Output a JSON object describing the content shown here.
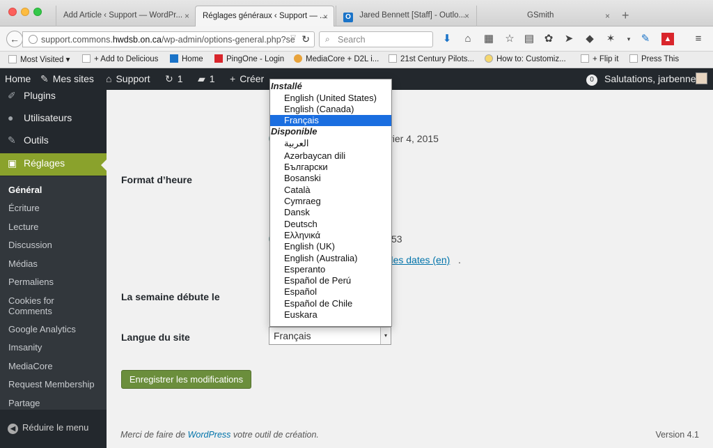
{
  "browser": {
    "tabs": [
      {
        "title": "Add Article ‹ Support — WordPr..."
      },
      {
        "title": "Réglages généraux ‹ Support — ..."
      },
      {
        "title": "Jared Bennett [Staff] - Outlo..."
      },
      {
        "title": "GSmith"
      }
    ],
    "close_glyph": "×",
    "newtab_glyph": "+",
    "url_prefix": "support.commons.",
    "url_host": "hwdsb.on.ca",
    "url_path": "/wp-admin/options-general.php?se",
    "search_placeholder": "Search",
    "bookmarks": [
      "Most Visited ▾",
      "+ Add to Delicious",
      "Home",
      "PingOne - Login",
      "MediaCore + D2L i...",
      "21st Century Pilots...",
      "How to: Customiz...",
      "+ Flip it",
      "Press This"
    ]
  },
  "adminbar": {
    "home": "Home",
    "mes_sites": "Mes sites",
    "site_name": "Support",
    "updates_count": "1",
    "comments_count": "1",
    "create": "Créer",
    "notif_count": "0",
    "greeting": "Salutations, jarbenne"
  },
  "sidebar": {
    "items": [
      {
        "label": "Plugins",
        "icon": "plugin-icon"
      },
      {
        "label": "Utilisateurs",
        "icon": "users-icon"
      },
      {
        "label": "Outils",
        "icon": "tools-icon"
      },
      {
        "label": "Réglages",
        "icon": "settings-icon"
      }
    ],
    "submenu": [
      "Général",
      "Écriture",
      "Lecture",
      "Discussion",
      "Médias",
      "Permaliens",
      "Cookies for Comments",
      "Google Analytics",
      "Imsanity",
      "MediaCore",
      "Request Membership",
      "Partage"
    ],
    "collapse": "Réduire le menu"
  },
  "content": {
    "date_fragment": "nvier 4, 2015",
    "time_label": "Format d’heure",
    "time_fragment": "53",
    "doc_link_fragment": "t des dates (en)",
    "week_label": "La semaine débute le",
    "lang_label": "Langue du site",
    "lang_value": "Français",
    "save_button": "Enregistrer les modifications",
    "footer_prefix": "Merci de faire de ",
    "footer_link": "WordPress",
    "footer_suffix": " votre outil de création.",
    "version": "Version 4.1"
  },
  "language_dropdown": {
    "installed_label": "Installé",
    "installed": [
      "English (United States)",
      "English (Canada)",
      "Français"
    ],
    "selected": "Français",
    "available_label": "Disponible",
    "available": [
      "العربية",
      "Azərbaycan dili",
      "Български",
      "Bosanski",
      "Català",
      "Cymraeg",
      "Dansk",
      "Deutsch",
      "Ελληνικά",
      "English (UK)",
      "English (Australia)",
      "Esperanto",
      "Español de Perú",
      "Español",
      "Español de Chile",
      "Euskara"
    ]
  },
  "colors": {
    "admin_bar": "#23282d",
    "accent_green": "#8aa22c",
    "save_button": "#6b8e3c",
    "selected_option": "#1a6ee0",
    "link": "#0073aa"
  }
}
